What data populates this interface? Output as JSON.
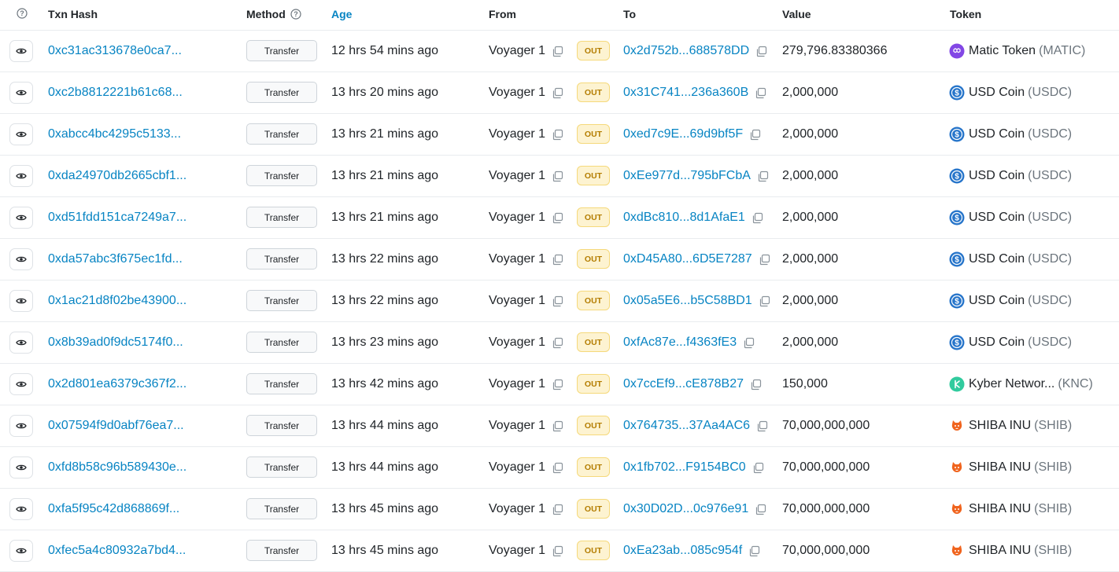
{
  "header": {
    "txn_hash": "Txn Hash",
    "method": "Method",
    "age": "Age",
    "from": "From",
    "to": "To",
    "value": "Value",
    "token": "Token"
  },
  "rows": [
    {
      "hash": "0xc31ac313678e0ca7...",
      "method": "Transfer",
      "age": "12 hrs 54 mins ago",
      "from": "Voyager 1",
      "direction": "OUT",
      "to": "0x2d752b...688578DD",
      "value": "279,796.83380366",
      "token_name": "Matic Token",
      "token_symbol": "(MATIC)",
      "token_icon": "matic-icon"
    },
    {
      "hash": "0xc2b8812221b61c68...",
      "method": "Transfer",
      "age": "13 hrs 20 mins ago",
      "from": "Voyager 1",
      "direction": "OUT",
      "to": "0x31C741...236a360B",
      "value": "2,000,000",
      "token_name": "USD Coin",
      "token_symbol": "(USDC)",
      "token_icon": "usdc-icon"
    },
    {
      "hash": "0xabcc4bc4295c5133...",
      "method": "Transfer",
      "age": "13 hrs 21 mins ago",
      "from": "Voyager 1",
      "direction": "OUT",
      "to": "0xed7c9E...69d9bf5F",
      "value": "2,000,000",
      "token_name": "USD Coin",
      "token_symbol": "(USDC)",
      "token_icon": "usdc-icon"
    },
    {
      "hash": "0xda24970db2665cbf1...",
      "method": "Transfer",
      "age": "13 hrs 21 mins ago",
      "from": "Voyager 1",
      "direction": "OUT",
      "to": "0xEe977d...795bFCbA",
      "value": "2,000,000",
      "token_name": "USD Coin",
      "token_symbol": "(USDC)",
      "token_icon": "usdc-icon"
    },
    {
      "hash": "0xd51fdd151ca7249a7...",
      "method": "Transfer",
      "age": "13 hrs 21 mins ago",
      "from": "Voyager 1",
      "direction": "OUT",
      "to": "0xdBc810...8d1AfaE1",
      "value": "2,000,000",
      "token_name": "USD Coin",
      "token_symbol": "(USDC)",
      "token_icon": "usdc-icon"
    },
    {
      "hash": "0xda57abc3f675ec1fd...",
      "method": "Transfer",
      "age": "13 hrs 22 mins ago",
      "from": "Voyager 1",
      "direction": "OUT",
      "to": "0xD45A80...6D5E7287",
      "value": "2,000,000",
      "token_name": "USD Coin",
      "token_symbol": "(USDC)",
      "token_icon": "usdc-icon"
    },
    {
      "hash": "0x1ac21d8f02be43900...",
      "method": "Transfer",
      "age": "13 hrs 22 mins ago",
      "from": "Voyager 1",
      "direction": "OUT",
      "to": "0x05a5E6...b5C58BD1",
      "value": "2,000,000",
      "token_name": "USD Coin",
      "token_symbol": "(USDC)",
      "token_icon": "usdc-icon"
    },
    {
      "hash": "0x8b39ad0f9dc5174f0...",
      "method": "Transfer",
      "age": "13 hrs 23 mins ago",
      "from": "Voyager 1",
      "direction": "OUT",
      "to": "0xfAc87e...f4363fE3",
      "value": "2,000,000",
      "token_name": "USD Coin",
      "token_symbol": "(USDC)",
      "token_icon": "usdc-icon"
    },
    {
      "hash": "0x2d801ea6379c367f2...",
      "method": "Transfer",
      "age": "13 hrs 42 mins ago",
      "from": "Voyager 1",
      "direction": "OUT",
      "to": "0x7ccEf9...cE878B27",
      "value": "150,000",
      "token_name": "Kyber Networ...",
      "token_symbol": "(KNC)",
      "token_icon": "kyber-icon"
    },
    {
      "hash": "0x07594f9d0abf76ea7...",
      "method": "Transfer",
      "age": "13 hrs 44 mins ago",
      "from": "Voyager 1",
      "direction": "OUT",
      "to": "0x764735...37Aa4AC6",
      "value": "70,000,000,000",
      "token_name": "SHIBA INU",
      "token_symbol": "(SHIB)",
      "token_icon": "shiba-icon"
    },
    {
      "hash": "0xfd8b58c96b589430e...",
      "method": "Transfer",
      "age": "13 hrs 44 mins ago",
      "from": "Voyager 1",
      "direction": "OUT",
      "to": "0x1fb702...F9154BC0",
      "value": "70,000,000,000",
      "token_name": "SHIBA INU",
      "token_symbol": "(SHIB)",
      "token_icon": "shiba-icon"
    },
    {
      "hash": "0xfa5f95c42d868869f...",
      "method": "Transfer",
      "age": "13 hrs 45 mins ago",
      "from": "Voyager 1",
      "direction": "OUT",
      "to": "0x30D02D...0c976e91",
      "value": "70,000,000,000",
      "token_name": "SHIBA INU",
      "token_symbol": "(SHIB)",
      "token_icon": "shiba-icon"
    },
    {
      "hash": "0xfec5a4c80932a7bd4...",
      "method": "Transfer",
      "age": "13 hrs 45 mins ago",
      "from": "Voyager 1",
      "direction": "OUT",
      "to": "0xEa23ab...085c954f",
      "value": "70,000,000,000",
      "token_name": "SHIBA INU",
      "token_symbol": "(SHIB)",
      "token_icon": "shiba-icon"
    }
  ],
  "colors": {
    "link": "#0784c3",
    "out_badge_bg": "#fdf3d1",
    "out_badge_text": "#b47d00",
    "matic": "#8247e5",
    "usdc": "#2775ca",
    "kyber": "#31cb9e",
    "shiba": "#f0641e"
  }
}
